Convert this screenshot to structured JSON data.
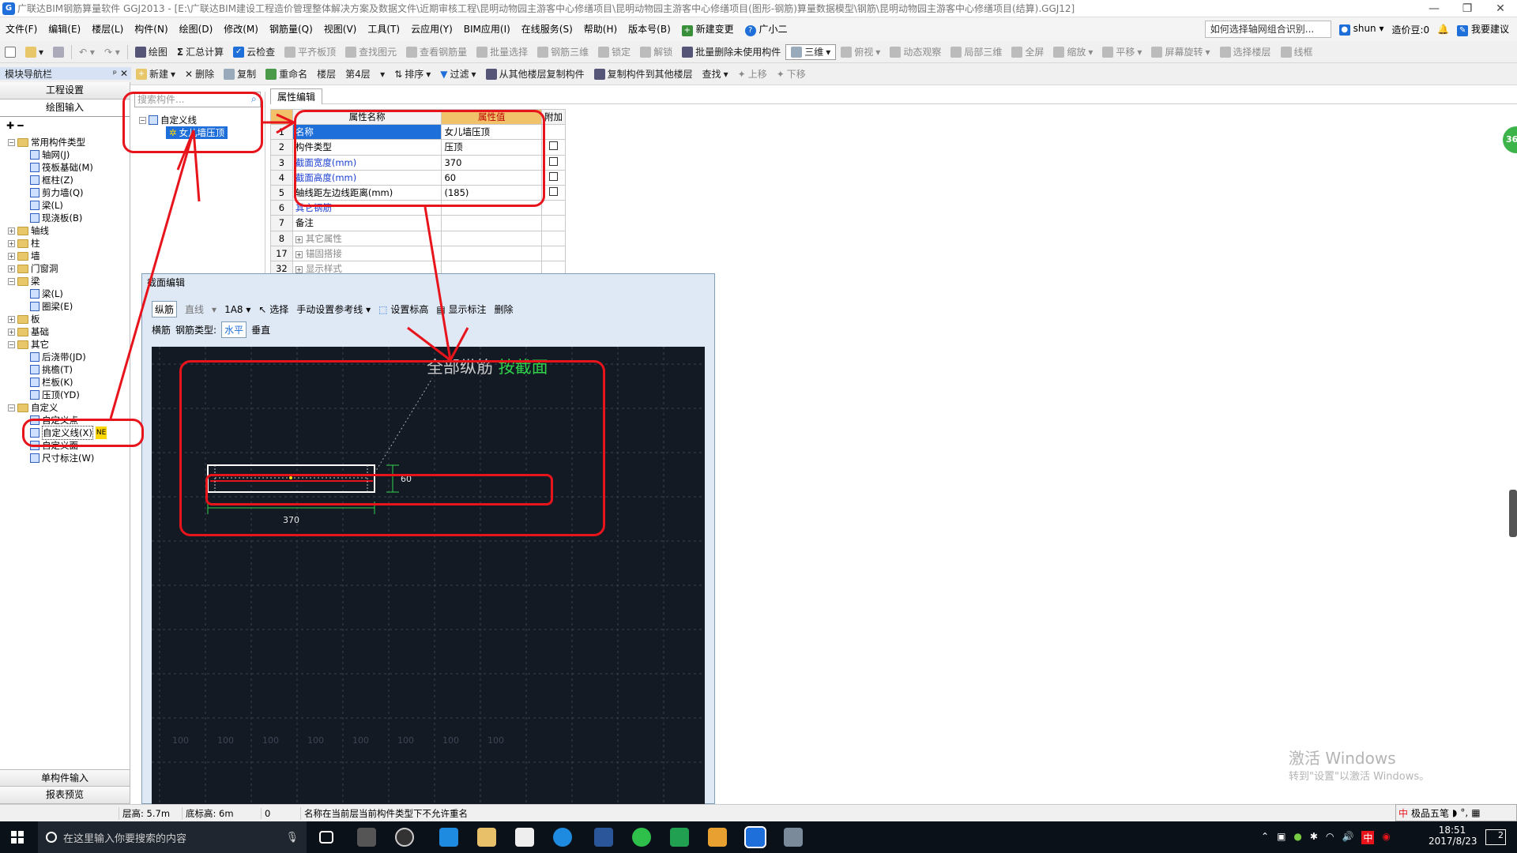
{
  "window": {
    "title": "广联达BIM钢筋算量软件 GGJ2013 - [E:\\广联达BIM建设工程造价管理整体解决方案及数据文件\\近期审核工程\\昆明动物园主游客中心修缮项目\\昆明动物园主游客中心修缮项目(图形-钢筋)算量数据模型\\钢筋\\昆明动物园主游客中心修缮项目(结算).GGJ12]"
  },
  "menubar": {
    "items": [
      "文件(F)",
      "编辑(E)",
      "楼层(L)",
      "构件(N)",
      "绘图(D)",
      "修改(M)",
      "钢筋量(Q)",
      "视图(V)",
      "工具(T)",
      "云应用(Y)",
      "BIM应用(I)",
      "在线服务(S)",
      "帮助(H)",
      "版本号(B)"
    ],
    "new_change": "新建变更",
    "assistant": "广小二",
    "help_search": "如何选择轴网组合识别...",
    "user": "shun",
    "beans": "造价豆:0",
    "suggest": "我要建议"
  },
  "toolbar1": {
    "items": [
      "绘图",
      "汇总计算",
      "云检查",
      "平齐板顶",
      "查找图元",
      "查看钢筋量",
      "批量选择",
      "钢筋三维",
      "锁定",
      "解锁",
      "批量删除未使用构件",
      "三维",
      "俯视",
      "动态观察",
      "局部三维",
      "全屏",
      "缩放",
      "平移",
      "屏幕旋转",
      "选择楼层",
      "线框"
    ]
  },
  "toolbar2": {
    "nav_title": "模块导航栏",
    "items": [
      "新建",
      "删除",
      "复制",
      "重命名",
      "楼层",
      "第4层",
      "排序",
      "过滤",
      "从其他楼层复制构件",
      "复制构件到其他楼层",
      "查找",
      "上移",
      "下移"
    ]
  },
  "nav": {
    "btn_project": "工程设置",
    "btn_draw": "绘图输入",
    "btn_single": "单构件输入",
    "btn_report": "报表预览",
    "tree": [
      {
        "label": "常用构件类型",
        "level": 0,
        "kind": "folder",
        "open": true
      },
      {
        "label": "轴网(J)",
        "level": 1,
        "kind": "item"
      },
      {
        "label": "筏板基础(M)",
        "level": 1,
        "kind": "item"
      },
      {
        "label": "框柱(Z)",
        "level": 1,
        "kind": "item"
      },
      {
        "label": "剪力墙(Q)",
        "level": 1,
        "kind": "item"
      },
      {
        "label": "梁(L)",
        "level": 1,
        "kind": "item"
      },
      {
        "label": "现浇板(B)",
        "level": 1,
        "kind": "item"
      },
      {
        "label": "轴线",
        "level": 0,
        "kind": "folder"
      },
      {
        "label": "柱",
        "level": 0,
        "kind": "folder"
      },
      {
        "label": "墙",
        "level": 0,
        "kind": "folder"
      },
      {
        "label": "门窗洞",
        "level": 0,
        "kind": "folder"
      },
      {
        "label": "梁",
        "level": 0,
        "kind": "folder",
        "open": true
      },
      {
        "label": "梁(L)",
        "level": 1,
        "kind": "item"
      },
      {
        "label": "圈梁(E)",
        "level": 1,
        "kind": "item"
      },
      {
        "label": "板",
        "level": 0,
        "kind": "folder"
      },
      {
        "label": "基础",
        "level": 0,
        "kind": "folder"
      },
      {
        "label": "其它",
        "level": 0,
        "kind": "folder",
        "open": true
      },
      {
        "label": "后浇带(JD)",
        "level": 1,
        "kind": "item"
      },
      {
        "label": "挑檐(T)",
        "level": 1,
        "kind": "item"
      },
      {
        "label": "栏板(K)",
        "level": 1,
        "kind": "item"
      },
      {
        "label": "压顶(YD)",
        "level": 1,
        "kind": "item"
      },
      {
        "label": "自定义",
        "level": 0,
        "kind": "folder",
        "open": true
      },
      {
        "label": "自定义点",
        "level": 1,
        "kind": "item"
      },
      {
        "label": "自定义线(X)",
        "level": 1,
        "kind": "item",
        "selected": true
      },
      {
        "label": "自定义面",
        "level": 1,
        "kind": "item"
      },
      {
        "label": "尺寸标注(W)",
        "level": 1,
        "kind": "item"
      }
    ]
  },
  "component_list": {
    "search_placeholder": "搜索构件...",
    "root": "自定义线",
    "child": "女儿墙压顶"
  },
  "properties": {
    "tab": "属性编辑",
    "headers": [
      "属性名称",
      "属性值",
      "附加"
    ],
    "rows": [
      {
        "n": "1",
        "name": "名称",
        "value": "女儿墙压顶",
        "blue": false,
        "check": false
      },
      {
        "n": "2",
        "name": "构件类型",
        "value": "压顶",
        "blue": false,
        "check": true
      },
      {
        "n": "3",
        "name": "截面宽度(mm)",
        "value": "370",
        "blue": true,
        "check": true
      },
      {
        "n": "4",
        "name": "截面高度(mm)",
        "value": "60",
        "blue": true,
        "check": true
      },
      {
        "n": "5",
        "name": "轴线距左边线距离(mm)",
        "value": "(185)",
        "blue": false,
        "check": true
      },
      {
        "n": "6",
        "name": "其它钢筋",
        "value": "",
        "blue": true,
        "check": false
      },
      {
        "n": "7",
        "name": "备注",
        "value": "",
        "blue": false,
        "check": false
      },
      {
        "n": "8",
        "name": "其它属性",
        "value": "",
        "blue": false,
        "check": false,
        "group": true
      },
      {
        "n": "17",
        "name": "锚固搭接",
        "value": "",
        "blue": false,
        "check": false,
        "group": true
      },
      {
        "n": "32",
        "name": "显示样式",
        "value": "",
        "blue": false,
        "check": false,
        "group": true
      }
    ]
  },
  "section_editor": {
    "title": "截面编辑",
    "tb_longitudinal": "纵筋",
    "tb_line": "直线",
    "tb_rebar": "1A8",
    "tb_select": "选择",
    "tb_refline": "手动设置参考线",
    "tb_set_mark": "设置标高",
    "tb_show_mark": "显示标注",
    "tb_delete": "删除",
    "row2_horizontal": "横筋",
    "row2_type_label": "钢筋类型:",
    "row2_level": "水平",
    "row2_vertical": "垂直",
    "annotation_prefix": "全部纵筋 ",
    "annotation_mode": "按截面",
    "dim_height": "60",
    "dim_width": "370",
    "grid_labels": [
      "100",
      "100",
      "100",
      "100",
      "100",
      "100",
      "100",
      "100"
    ]
  },
  "watermark": {
    "line1": "激活 Windows",
    "line2": "转到\"设置\"以激活 Windows。"
  },
  "status": {
    "floor_height": "层高: 5.7m",
    "bottom_elev": "底标高: 6m",
    "zero": "0",
    "message": "名称在当前层当前构件类型下不允许重名",
    "ime": "极品五笔"
  },
  "taskbar": {
    "search": "在这里输入你要搜索的内容",
    "time": "18:51",
    "date": "2017/8/23",
    "notif": "2",
    "ime": "中"
  },
  "badge": "36",
  "colors": {
    "accent_red": "#e8141c",
    "canvas_bg": "#141a24",
    "header_orange": "#f2c26a",
    "selection_blue": "#1e6fd9",
    "annotation_green": "#2fd24a"
  }
}
